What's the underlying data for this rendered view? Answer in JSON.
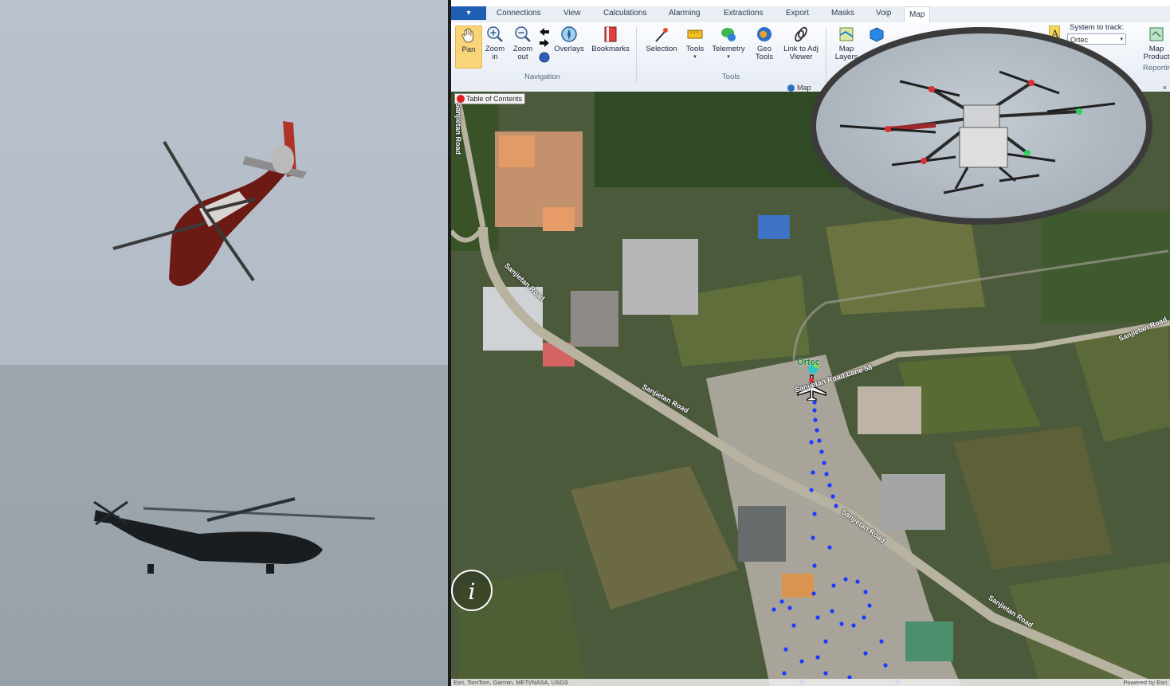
{
  "ribbon": {
    "tabs": [
      "Connections",
      "View",
      "Calculations",
      "Alarming",
      "Extractions",
      "Export",
      "Masks",
      "Voip",
      "Map"
    ],
    "active_tab": "Map",
    "buttons": {
      "pan": "Pan",
      "zoom_in": "Zoom in",
      "zoom_out": "Zoom out",
      "overlays": "Overlays",
      "bookmarks": "Bookmarks",
      "selection": "Selection",
      "tools": "Tools",
      "telemetry": "Telemetry",
      "geo_tools": "Geo Tools",
      "link_viewer": "Link to Adj Viewer",
      "map_layers": "Map Layers",
      "map_product": "Map Product",
      "reporting": "Reportin"
    },
    "groups": {
      "navigation": "Navigation",
      "tools": "Tools",
      "map": "Map"
    },
    "system_to_track_label": "System to track:",
    "system_to_track_value": "Ortec"
  },
  "map": {
    "toc_label": "Table of Contents",
    "track_label": "Ortec",
    "roads": {
      "r1": "Sanjietan Road",
      "r2": "Sanjietan Road",
      "r3": "Sanjietan Road",
      "r4": "Sanjietan Road",
      "r5": "Sanjietan Road",
      "r6": "Sanjietan Road",
      "lane": "Sanjietan Road Lane 58"
    },
    "attribution": "Esri, TomTom, Garmin, METI/NASA, USGS",
    "powered_by": "Powered by Esri",
    "info_glyph": "i"
  },
  "colors": {
    "track_dots": "#1d3bff",
    "road": "#b8b2a0",
    "ribbon_accent": "#1e5fb4"
  }
}
